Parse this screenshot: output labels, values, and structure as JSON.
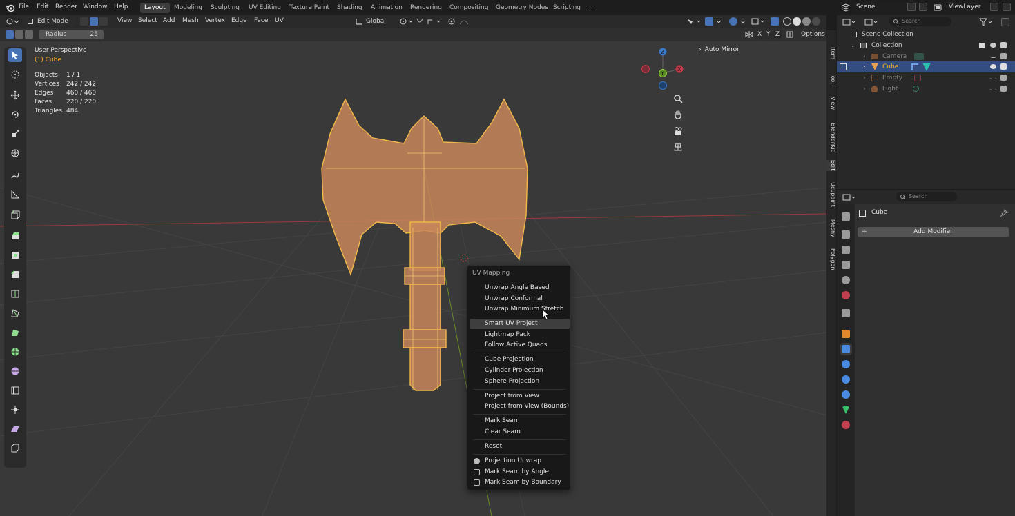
{
  "menubar": {
    "items": [
      "File",
      "Edit",
      "Render",
      "Window",
      "Help"
    ],
    "workspaces": [
      "Layout",
      "Modeling",
      "Sculpting",
      "UV Editing",
      "Texture Paint",
      "Shading",
      "Animation",
      "Rendering",
      "Compositing",
      "Geometry Nodes",
      "Scripting"
    ],
    "active_workspace": "Layout",
    "add_tab": "+",
    "scene": "Scene",
    "view_layer": "ViewLayer"
  },
  "viewport_header": {
    "mode": "Edit Mode",
    "menus": [
      "View",
      "Select",
      "Add",
      "Mesh",
      "Vertex",
      "Edge",
      "Face",
      "UV"
    ],
    "transform_orientation": "Global",
    "tool_radius_label": "Radius",
    "tool_radius_value": "25",
    "axis_x": "X",
    "axis_y": "Y",
    "axis_z": "Z",
    "options": "Options"
  },
  "overlay": {
    "view_name": "User Perspective",
    "object_name": "(1) Cube",
    "stats": [
      {
        "label": "Objects",
        "value": "1 / 1"
      },
      {
        "label": "Vertices",
        "value": "242 / 242"
      },
      {
        "label": "Edges",
        "value": "460 / 460"
      },
      {
        "label": "Faces",
        "value": "220 / 220"
      },
      {
        "label": "Triangles",
        "value": "484"
      }
    ],
    "auto_mirror": "Auto Mirror"
  },
  "gizmo": {
    "x": "X",
    "y": "Y",
    "z": "Z"
  },
  "side_tabs": [
    "Item",
    "Tool",
    "View",
    "BlenderKit",
    "Edit",
    "Ucupaint",
    "Meshy",
    "Polygon"
  ],
  "outliner": {
    "search_placeholder": "Search",
    "scene_collection": "Scene Collection",
    "collection": "Collection",
    "items": [
      {
        "name": "Camera"
      },
      {
        "name": "Cube"
      },
      {
        "name": "Empty"
      },
      {
        "name": "Light"
      }
    ]
  },
  "properties": {
    "search_placeholder": "Search",
    "object_name": "Cube",
    "add_modifier": "Add Modifier"
  },
  "context_menu": {
    "title": "UV Mapping",
    "items": [
      "Unwrap Angle Based",
      "Unwrap Conformal",
      "Unwrap Minimum Stretch",
      "Smart UV Project",
      "Lightmap Pack",
      "Follow Active Quads",
      "Cube Projection",
      "Cylinder Projection",
      "Sphere Projection",
      "Project from View",
      "Project from View (Bounds)",
      "Mark Seam",
      "Clear Seam",
      "Reset",
      "Projection Unwrap",
      "Mark Seam by Angle",
      "Mark Seam by Boundary"
    ],
    "highlighted": "Smart UV Project"
  },
  "colors": {
    "selection_orange": "#ffaf29",
    "active_blue": "#4772b3",
    "mesh_fill": "#c8875a"
  }
}
